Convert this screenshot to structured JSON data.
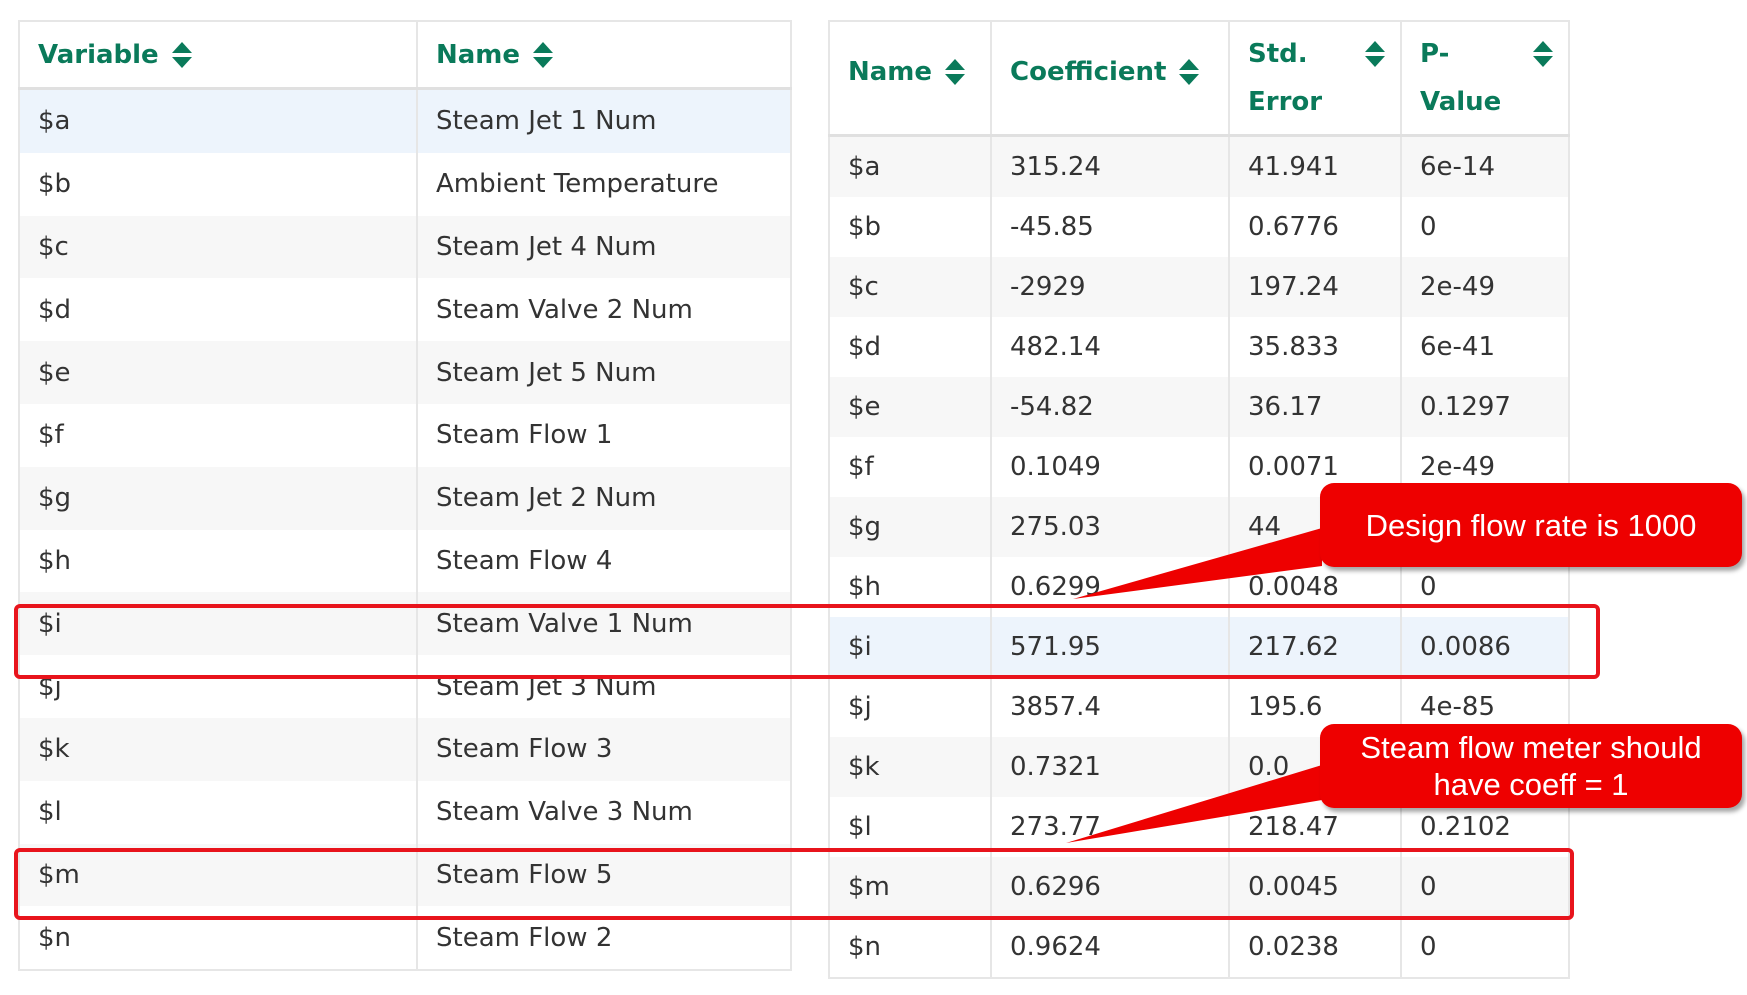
{
  "variables_table": {
    "headers": {
      "variable": "Variable",
      "name": "Name"
    },
    "rows": [
      {
        "variable": "$a",
        "name": "Steam Jet 1 Num"
      },
      {
        "variable": "$b",
        "name": "Ambient Temperature"
      },
      {
        "variable": "$c",
        "name": "Steam Jet 4 Num"
      },
      {
        "variable": "$d",
        "name": "Steam Valve 2 Num"
      },
      {
        "variable": "$e",
        "name": "Steam Jet 5 Num"
      },
      {
        "variable": "$f",
        "name": "Steam Flow 1"
      },
      {
        "variable": "$g",
        "name": "Steam Jet 2 Num"
      },
      {
        "variable": "$h",
        "name": "Steam Flow 4"
      },
      {
        "variable": "$i",
        "name": "Steam Valve 1 Num"
      },
      {
        "variable": "$j",
        "name": "Steam Jet 3 Num"
      },
      {
        "variable": "$k",
        "name": "Steam Flow 3"
      },
      {
        "variable": "$l",
        "name": "Steam Valve 3 Num"
      },
      {
        "variable": "$m",
        "name": "Steam Flow 5"
      },
      {
        "variable": "$n",
        "name": "Steam Flow 2"
      }
    ]
  },
  "coefficients_table": {
    "headers": {
      "name": "Name",
      "coefficient": "Coefficient",
      "std_error_1": "Std.",
      "std_error_2": "Error",
      "p_value_1": "P-",
      "p_value_2": "Value"
    },
    "rows": [
      {
        "name": "$a",
        "coefficient": "315.24",
        "std_error": "41.941",
        "p_value": "6e-14"
      },
      {
        "name": "$b",
        "coefficient": "-45.85",
        "std_error": "0.6776",
        "p_value": "0"
      },
      {
        "name": "$c",
        "coefficient": "-2929",
        "std_error": "197.24",
        "p_value": "2e-49"
      },
      {
        "name": "$d",
        "coefficient": "482.14",
        "std_error": "35.833",
        "p_value": "6e-41"
      },
      {
        "name": "$e",
        "coefficient": "-54.82",
        "std_error": "36.17",
        "p_value": "0.1297"
      },
      {
        "name": "$f",
        "coefficient": "0.1049",
        "std_error": "0.0071",
        "p_value": "2e-49"
      },
      {
        "name": "$g",
        "coefficient": "275.03",
        "std_error": "44",
        "p_value": ""
      },
      {
        "name": "$h",
        "coefficient": "0.6299",
        "std_error": "0.0048",
        "p_value": "0"
      },
      {
        "name": "$i",
        "coefficient": "571.95",
        "std_error": "217.62",
        "p_value": "0.0086"
      },
      {
        "name": "$j",
        "coefficient": "3857.4",
        "std_error": "195.6",
        "p_value": "4e-85"
      },
      {
        "name": "$k",
        "coefficient": "0.7321",
        "std_error": "0.0",
        "p_value": ""
      },
      {
        "name": "$l",
        "coefficient": "273.77",
        "std_error": "218.47",
        "p_value": "0.2102"
      },
      {
        "name": "$m",
        "coefficient": "0.6296",
        "std_error": "0.0045",
        "p_value": "0"
      },
      {
        "name": "$n",
        "coefficient": "0.9624",
        "std_error": "0.0238",
        "p_value": "0"
      }
    ]
  },
  "annotations": {
    "callout_1": "Design flow rate is 1000",
    "callout_2_line1": "Steam flow meter should",
    "callout_2_line2": "have coeff = 1"
  },
  "colors": {
    "header_text": "#0a7a5a",
    "highlight_border": "#e8141c",
    "callout_fill": "#ee0000",
    "selected_row": "#edf4fc"
  }
}
